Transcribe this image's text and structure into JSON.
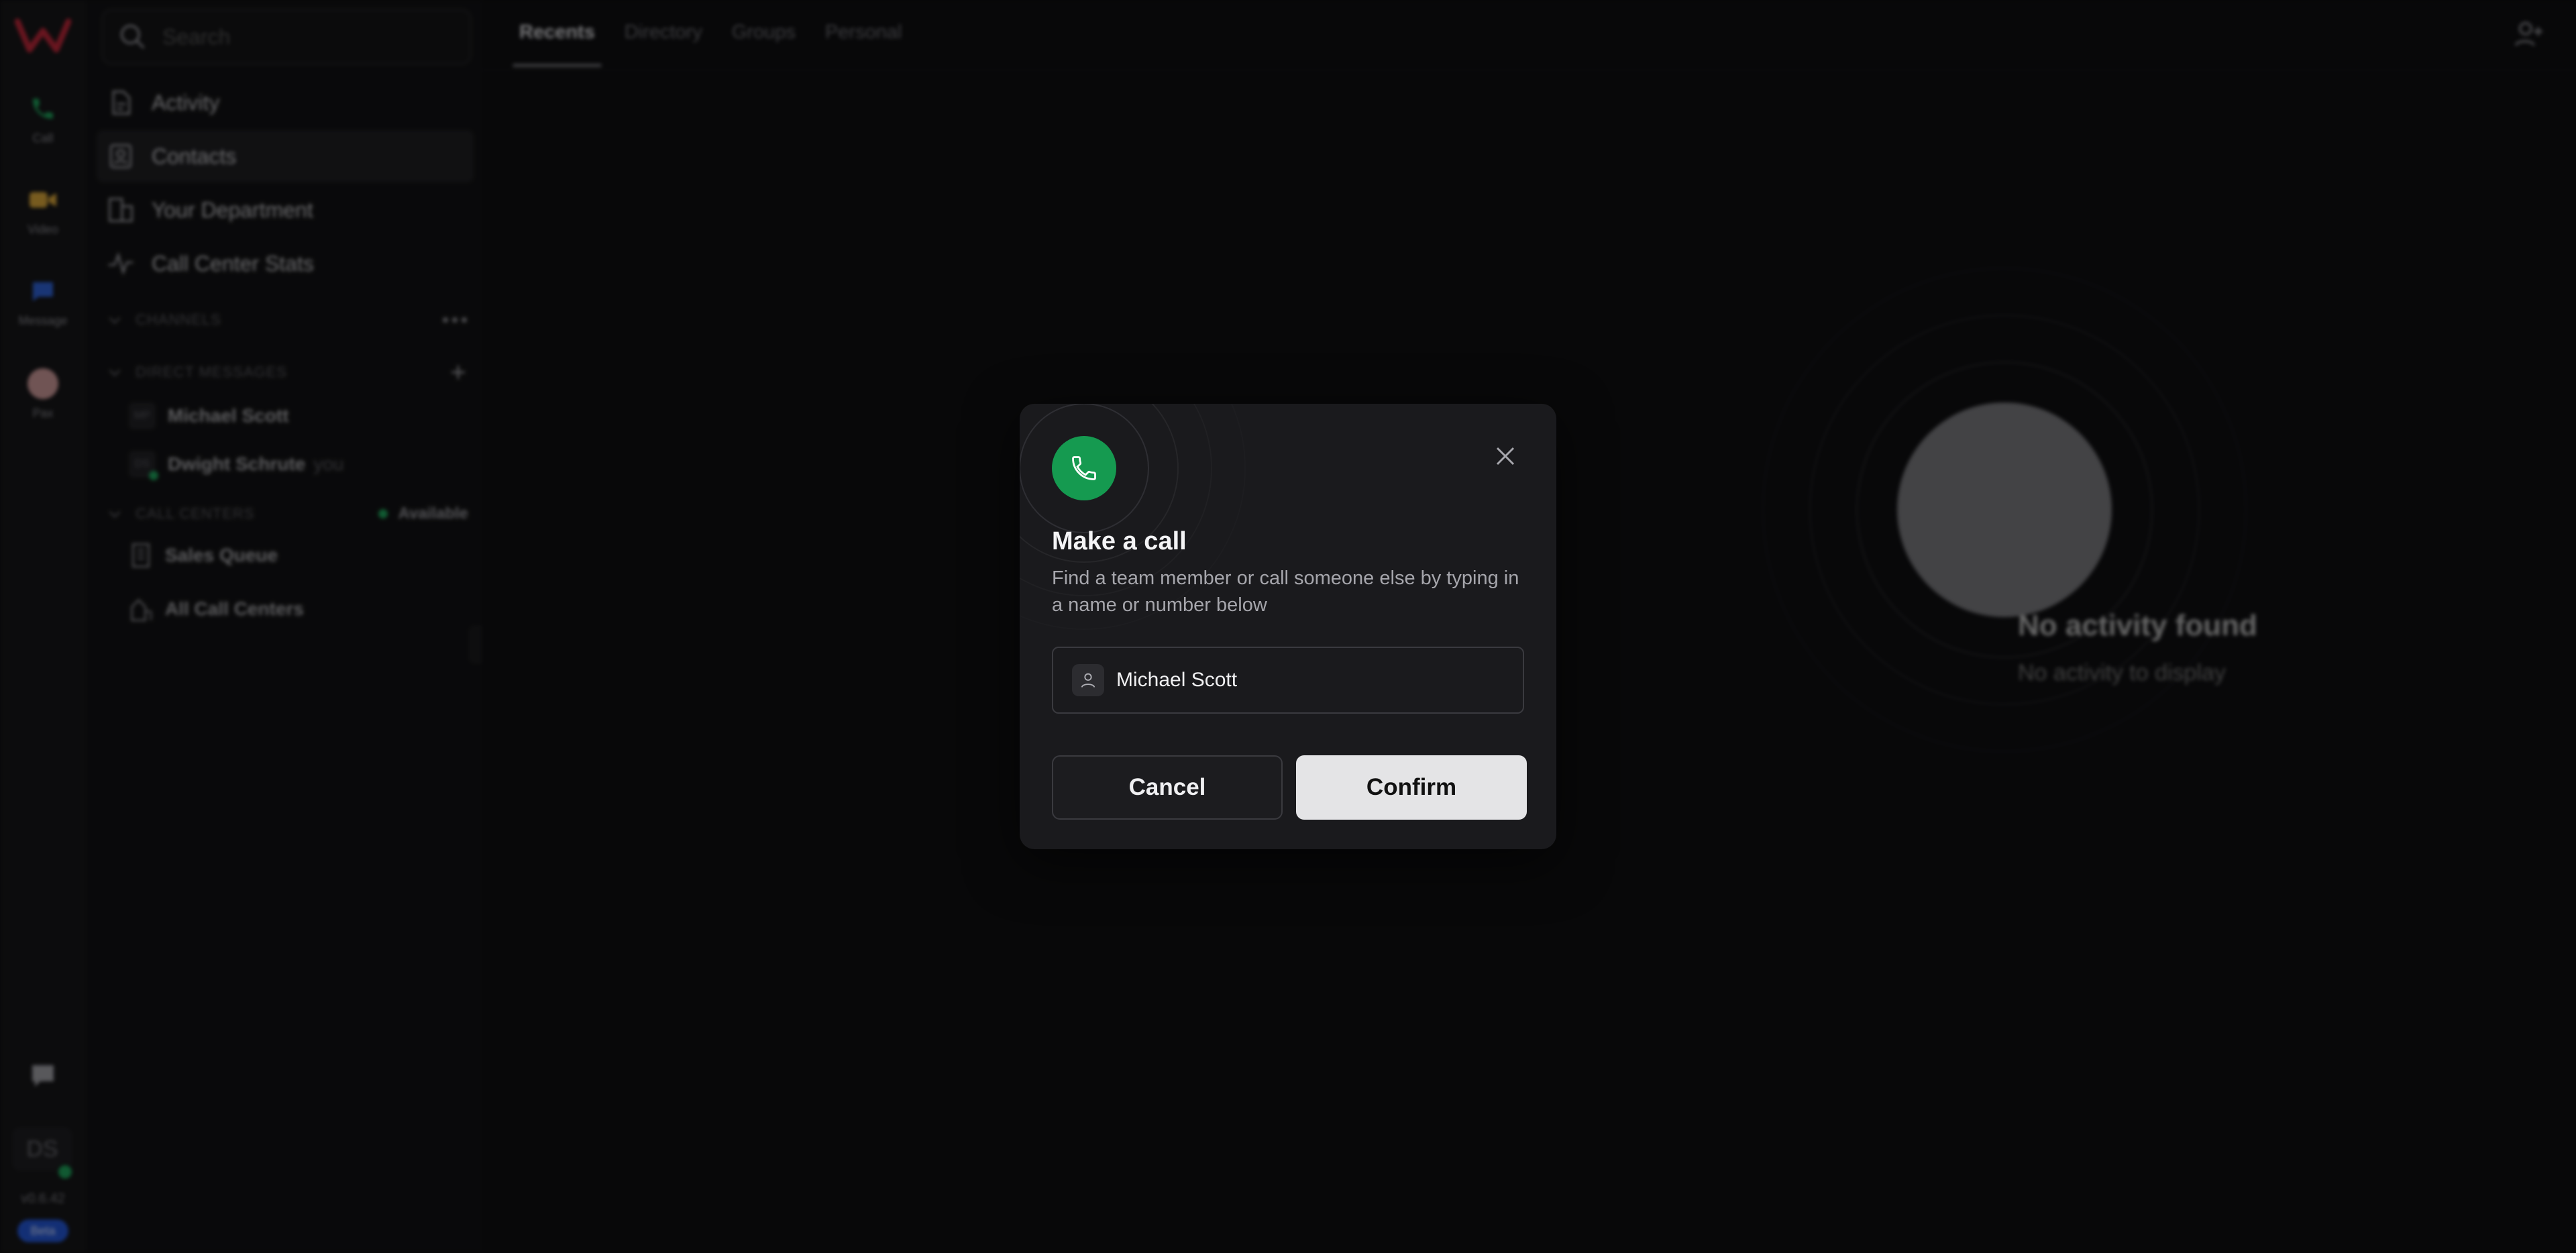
{
  "rail": {
    "items": [
      {
        "label": "Call",
        "color": "#1fa35b"
      },
      {
        "label": "Video",
        "color": "#d9a63a"
      },
      {
        "label": "Message",
        "color": "#2f62d6"
      },
      {
        "label": "Pax"
      }
    ],
    "user_initials": "DS",
    "version": "v0.6.42",
    "beta_label": "Beta"
  },
  "sidebar": {
    "search_placeholder": "Search",
    "nav": [
      {
        "label": "Activity"
      },
      {
        "label": "Contacts"
      },
      {
        "label": "Your Department"
      },
      {
        "label": "Call Center Stats"
      }
    ],
    "channels_header": "CHANNELS",
    "dm_header": "DIRECT MESSAGES",
    "direct_messages": [
      {
        "initials": "MP",
        "name": "Michael Scott",
        "suffix": ""
      },
      {
        "initials": "DS",
        "name": "Dwight Schrute",
        "suffix": "you"
      }
    ],
    "call_centers_header": "CALL CENTERS",
    "call_center_status": "Available",
    "call_centers": [
      {
        "name": "Sales Queue"
      },
      {
        "name": "All Call Centers"
      }
    ]
  },
  "main": {
    "tabs": [
      {
        "label": "Recents"
      },
      {
        "label": "Directory"
      },
      {
        "label": "Groups"
      },
      {
        "label": "Personal"
      }
    ],
    "empty_title": "No activity found",
    "empty_subtitle": "No activity to display"
  },
  "modal": {
    "title": "Make a call",
    "description": "Find a team member or call someone else by typing in a name or number below",
    "input_value": "Michael Scott",
    "cancel_label": "Cancel",
    "confirm_label": "Confirm",
    "accent_color": "#159a50"
  }
}
